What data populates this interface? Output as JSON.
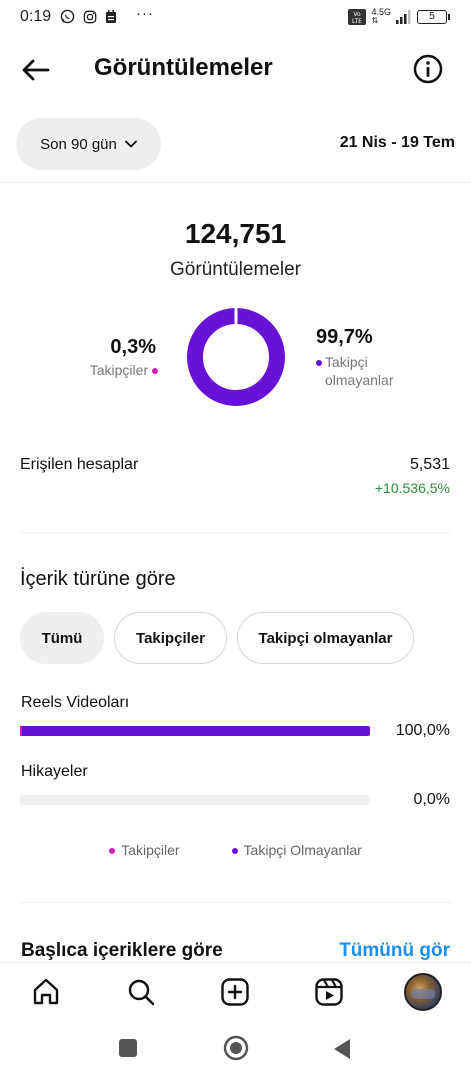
{
  "status_bar": {
    "time": "0:19",
    "overflow": "···",
    "network": "4.5G",
    "lte": "LTE",
    "battery": "5"
  },
  "header": {
    "title": "Görüntülemeler",
    "back_icon": "arrow-left-icon",
    "info_icon": "info-icon"
  },
  "filters": {
    "range_label": "Son 90 gün",
    "date_range": "21 Nis - 19 Tem"
  },
  "summary": {
    "total": "124,751",
    "total_label": "Görüntülemeler",
    "followers_pct": "0,3%",
    "followers_label": "Takipçiler",
    "non_followers_pct": "99,7%",
    "non_followers_label_line1": "Takipçi",
    "non_followers_label_line2": "olmayanlar",
    "followers_share": 0.003,
    "colors": {
      "followers": "#d31fb6",
      "non_followers": "#6812d6"
    }
  },
  "reach": {
    "label": "Erişilen hesaplar",
    "value": "5,531",
    "change": "+10.536,5%"
  },
  "content_type": {
    "title": "İçerik türüne göre",
    "chips": [
      "Tümü",
      "Takipçiler",
      "Takipçi olmayanlar"
    ],
    "active_chip": "Tümü",
    "bars": [
      {
        "label": "Reels Videoları",
        "pct": "100,0%",
        "fraction": 1.0
      },
      {
        "label": "Hikayeler",
        "pct": "0,0%",
        "fraction": 0.0
      }
    ],
    "legend": [
      "Takipçiler",
      "Takipçi Olmayanlar"
    ]
  },
  "top_content": {
    "title": "Başlıca içeriklere göre",
    "see_all": "Tümünü gör"
  },
  "bottom_nav": {
    "items": [
      "home-icon",
      "search-icon",
      "create-icon",
      "reels-icon",
      "profile-avatar"
    ]
  },
  "system_nav": {
    "items": [
      "recents-icon",
      "home-icon",
      "back-icon"
    ]
  }
}
